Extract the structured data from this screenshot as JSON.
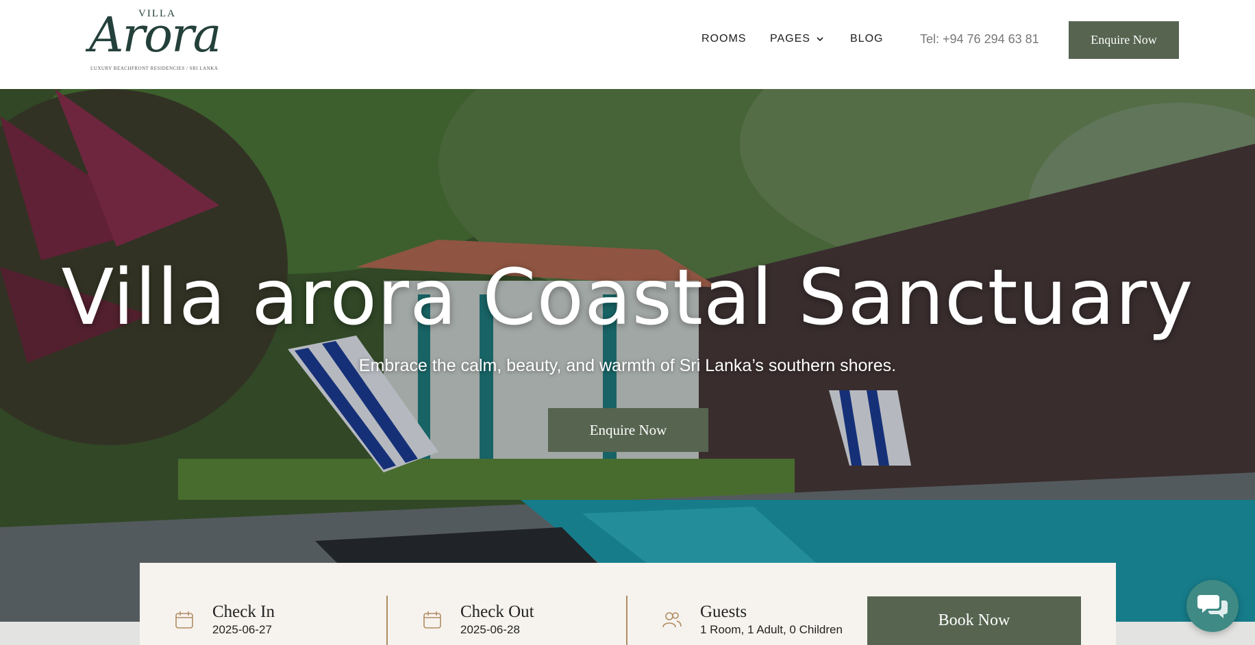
{
  "brand": {
    "small": "VILLA",
    "name": "Arora",
    "tagline": "LUXURY BEACHFRONT RESIDENCIES / SRI LANKA"
  },
  "nav": {
    "items": [
      {
        "label": "ROOMS"
      },
      {
        "label": "PAGES"
      },
      {
        "label": "BLOG"
      }
    ],
    "phone": "Tel:  +94 76 294 63 81",
    "cta": "Enquire Now"
  },
  "hero": {
    "title": "Villa arora Coastal Sanctuary",
    "subtitle": "Embrace the calm, beauty, and warmth of Sri Lanka’s southern shores.",
    "cta": "Enquire Now"
  },
  "booking": {
    "checkin": {
      "label": "Check In",
      "value": "2025-06-27"
    },
    "checkout": {
      "label": "Check Out",
      "value": "2025-06-28"
    },
    "guests": {
      "label": "Guests",
      "value": "1 Room, 1 Adult, 0 Children"
    },
    "button": "Book Now"
  },
  "colors": {
    "accent": "#566450",
    "brand_text": "#24403a",
    "booking_bg": "#f6f3ee",
    "icon_accent": "#b08b63",
    "chat": "#3f8a84"
  },
  "icons": {
    "dropdown": "chevron-down-icon",
    "date": "calendar-icon",
    "guests": "users-icon",
    "chat": "chat-bubbles-icon"
  }
}
